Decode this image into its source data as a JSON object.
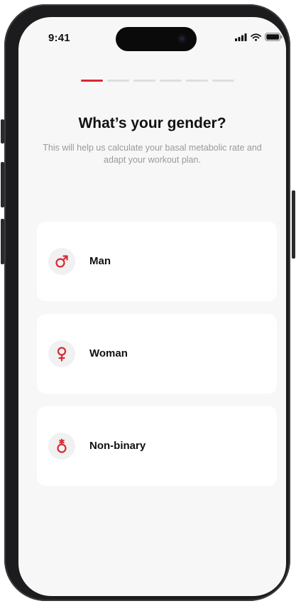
{
  "status_bar": {
    "time": "9:41",
    "icons": [
      "signal-icon",
      "wifi-icon",
      "battery-icon"
    ]
  },
  "progress": {
    "total_steps": 6,
    "current_step": 1,
    "accent_color": "#d62a34"
  },
  "header": {
    "title": "What’s your gender?",
    "subtitle": "This will help us calculate your basal metabolic rate and adapt your workout plan."
  },
  "options": [
    {
      "label": "Man",
      "icon": "male-symbol-icon"
    },
    {
      "label": "Woman",
      "icon": "female-symbol-icon"
    },
    {
      "label": "Non-binary",
      "icon": "non-binary-symbol-icon"
    }
  ],
  "colors": {
    "accent": "#d62a34",
    "background": "#f7f7f7",
    "card": "#ffffff"
  }
}
